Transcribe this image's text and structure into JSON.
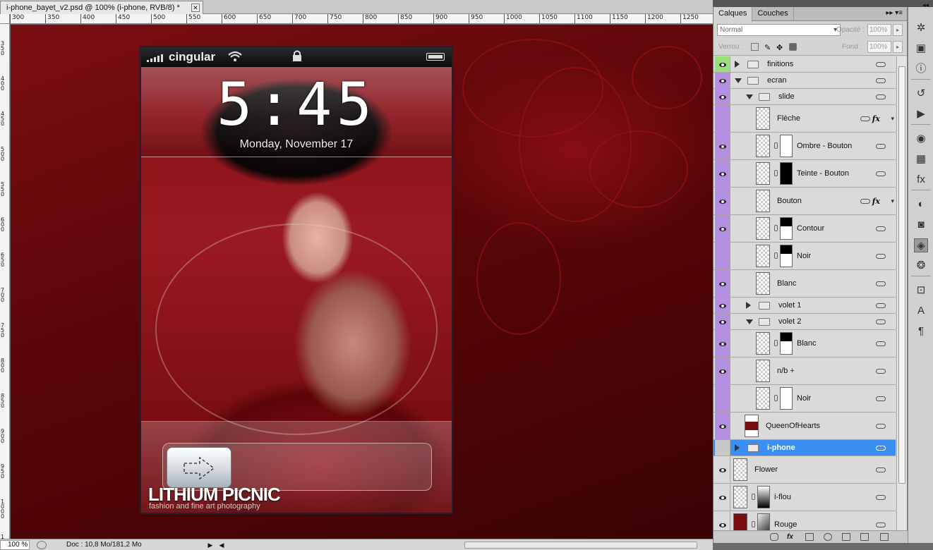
{
  "document": {
    "tab_title": "i-phone_bayet_v2.psd @ 100% (i-phone, RVB/8) *",
    "close_label": "✕"
  },
  "ruler": {
    "h_labels": [
      "300",
      "350",
      "400",
      "450",
      "500",
      "550",
      "600",
      "650",
      "700",
      "750",
      "800",
      "850",
      "900",
      "950",
      "1000",
      "1050",
      "1100",
      "1150",
      "1200",
      "1250"
    ],
    "v_labels": [
      "350",
      "400",
      "450",
      "500",
      "550",
      "600",
      "650",
      "700",
      "750",
      "800",
      "850",
      "900",
      "950",
      "1000",
      "1050"
    ]
  },
  "phone": {
    "carrier": "cingular",
    "time": "5:45",
    "date": "Monday, November 17",
    "brand": "LITHIUM PICNIC",
    "tagline": "fashion and fine art photography"
  },
  "status": {
    "zoom": "100 %",
    "doc_info": "Doc : 10,8 Mo/181,2 Mo",
    "next_arrow": "▶",
    "prev_arrow": "◀"
  },
  "layers_panel": {
    "tabs": [
      "Calques",
      "Couches"
    ],
    "blend_mode": "Normal",
    "opacity_label": "Opacité :",
    "opacity_value": "100%",
    "lock_label": "Verrou :",
    "fill_label": "Fond :",
    "fill_value": "100%",
    "layers": [
      {
        "name": "finitions",
        "kind": "group",
        "depth": 0,
        "expanded": false,
        "visible": true,
        "eye_color": "green"
      },
      {
        "name": "ecran",
        "kind": "group",
        "depth": 0,
        "expanded": true,
        "visible": true,
        "eye_color": "purple"
      },
      {
        "name": "slide",
        "kind": "group",
        "depth": 1,
        "expanded": true,
        "visible": true,
        "eye_color": "purple"
      },
      {
        "name": "Flèche",
        "kind": "layer",
        "depth": 2,
        "visible": false,
        "eye_color": "purple",
        "fx": true
      },
      {
        "name": "Ombre - Bouton",
        "kind": "masked",
        "depth": 2,
        "visible": true,
        "eye_color": "purple",
        "mask": "white"
      },
      {
        "name": "Teinte - Bouton",
        "kind": "masked",
        "depth": 2,
        "visible": true,
        "eye_color": "purple",
        "mask": "black"
      },
      {
        "name": "Bouton",
        "kind": "layer",
        "depth": 2,
        "visible": true,
        "eye_color": "purple",
        "fx": true
      },
      {
        "name": "Contour",
        "kind": "masked",
        "depth": 2,
        "visible": true,
        "eye_color": "purple",
        "mask": "split"
      },
      {
        "name": "Noir",
        "kind": "masked",
        "depth": 2,
        "visible": false,
        "eye_color": "purple",
        "mask": "split"
      },
      {
        "name": "Blanc",
        "kind": "layer",
        "depth": 2,
        "visible": true,
        "eye_color": "purple"
      },
      {
        "name": "volet 1",
        "kind": "group",
        "depth": 1,
        "expanded": false,
        "visible": true,
        "eye_color": "purple"
      },
      {
        "name": "volet 2",
        "kind": "group",
        "depth": 1,
        "expanded": true,
        "visible": true,
        "eye_color": "purple"
      },
      {
        "name": "Blanc",
        "kind": "masked",
        "depth": 2,
        "visible": true,
        "eye_color": "purple",
        "mask": "split"
      },
      {
        "name": "n/b +",
        "kind": "layer",
        "depth": 2,
        "visible": true,
        "eye_color": "purple"
      },
      {
        "name": "Noir",
        "kind": "masked",
        "depth": 2,
        "visible": false,
        "eye_color": "purple",
        "mask": "white"
      },
      {
        "name": "QueenOfHearts",
        "kind": "photo",
        "depth": 1,
        "visible": true,
        "eye_color": "purple"
      },
      {
        "name": "i-phone",
        "kind": "group",
        "depth": 0,
        "expanded": false,
        "visible": false,
        "selected": true
      },
      {
        "name": "Flower",
        "kind": "layer",
        "depth": 0,
        "visible": true
      },
      {
        "name": "i-flou",
        "kind": "masked",
        "depth": 0,
        "visible": true,
        "mask": "gradient"
      },
      {
        "name": "Rouge",
        "kind": "masked",
        "depth": 0,
        "visible": true,
        "mask": "gradient2",
        "thumb_color": "#7a0d10"
      }
    ]
  },
  "tools": [
    "compass-icon",
    "image-icon",
    "info-icon",
    "history-icon",
    "actions-icon",
    "palette-icon",
    "swatches-icon",
    "styles-icon",
    "adjust-icon",
    "mask-icon",
    "layers-icon",
    "channels-icon",
    "transform-icon",
    "character-icon",
    "paragraph-icon"
  ],
  "colors": {
    "selection_blue": "#3b8ff2",
    "group_purple": "#b48ee0",
    "canvas_red": "#6a080c"
  }
}
